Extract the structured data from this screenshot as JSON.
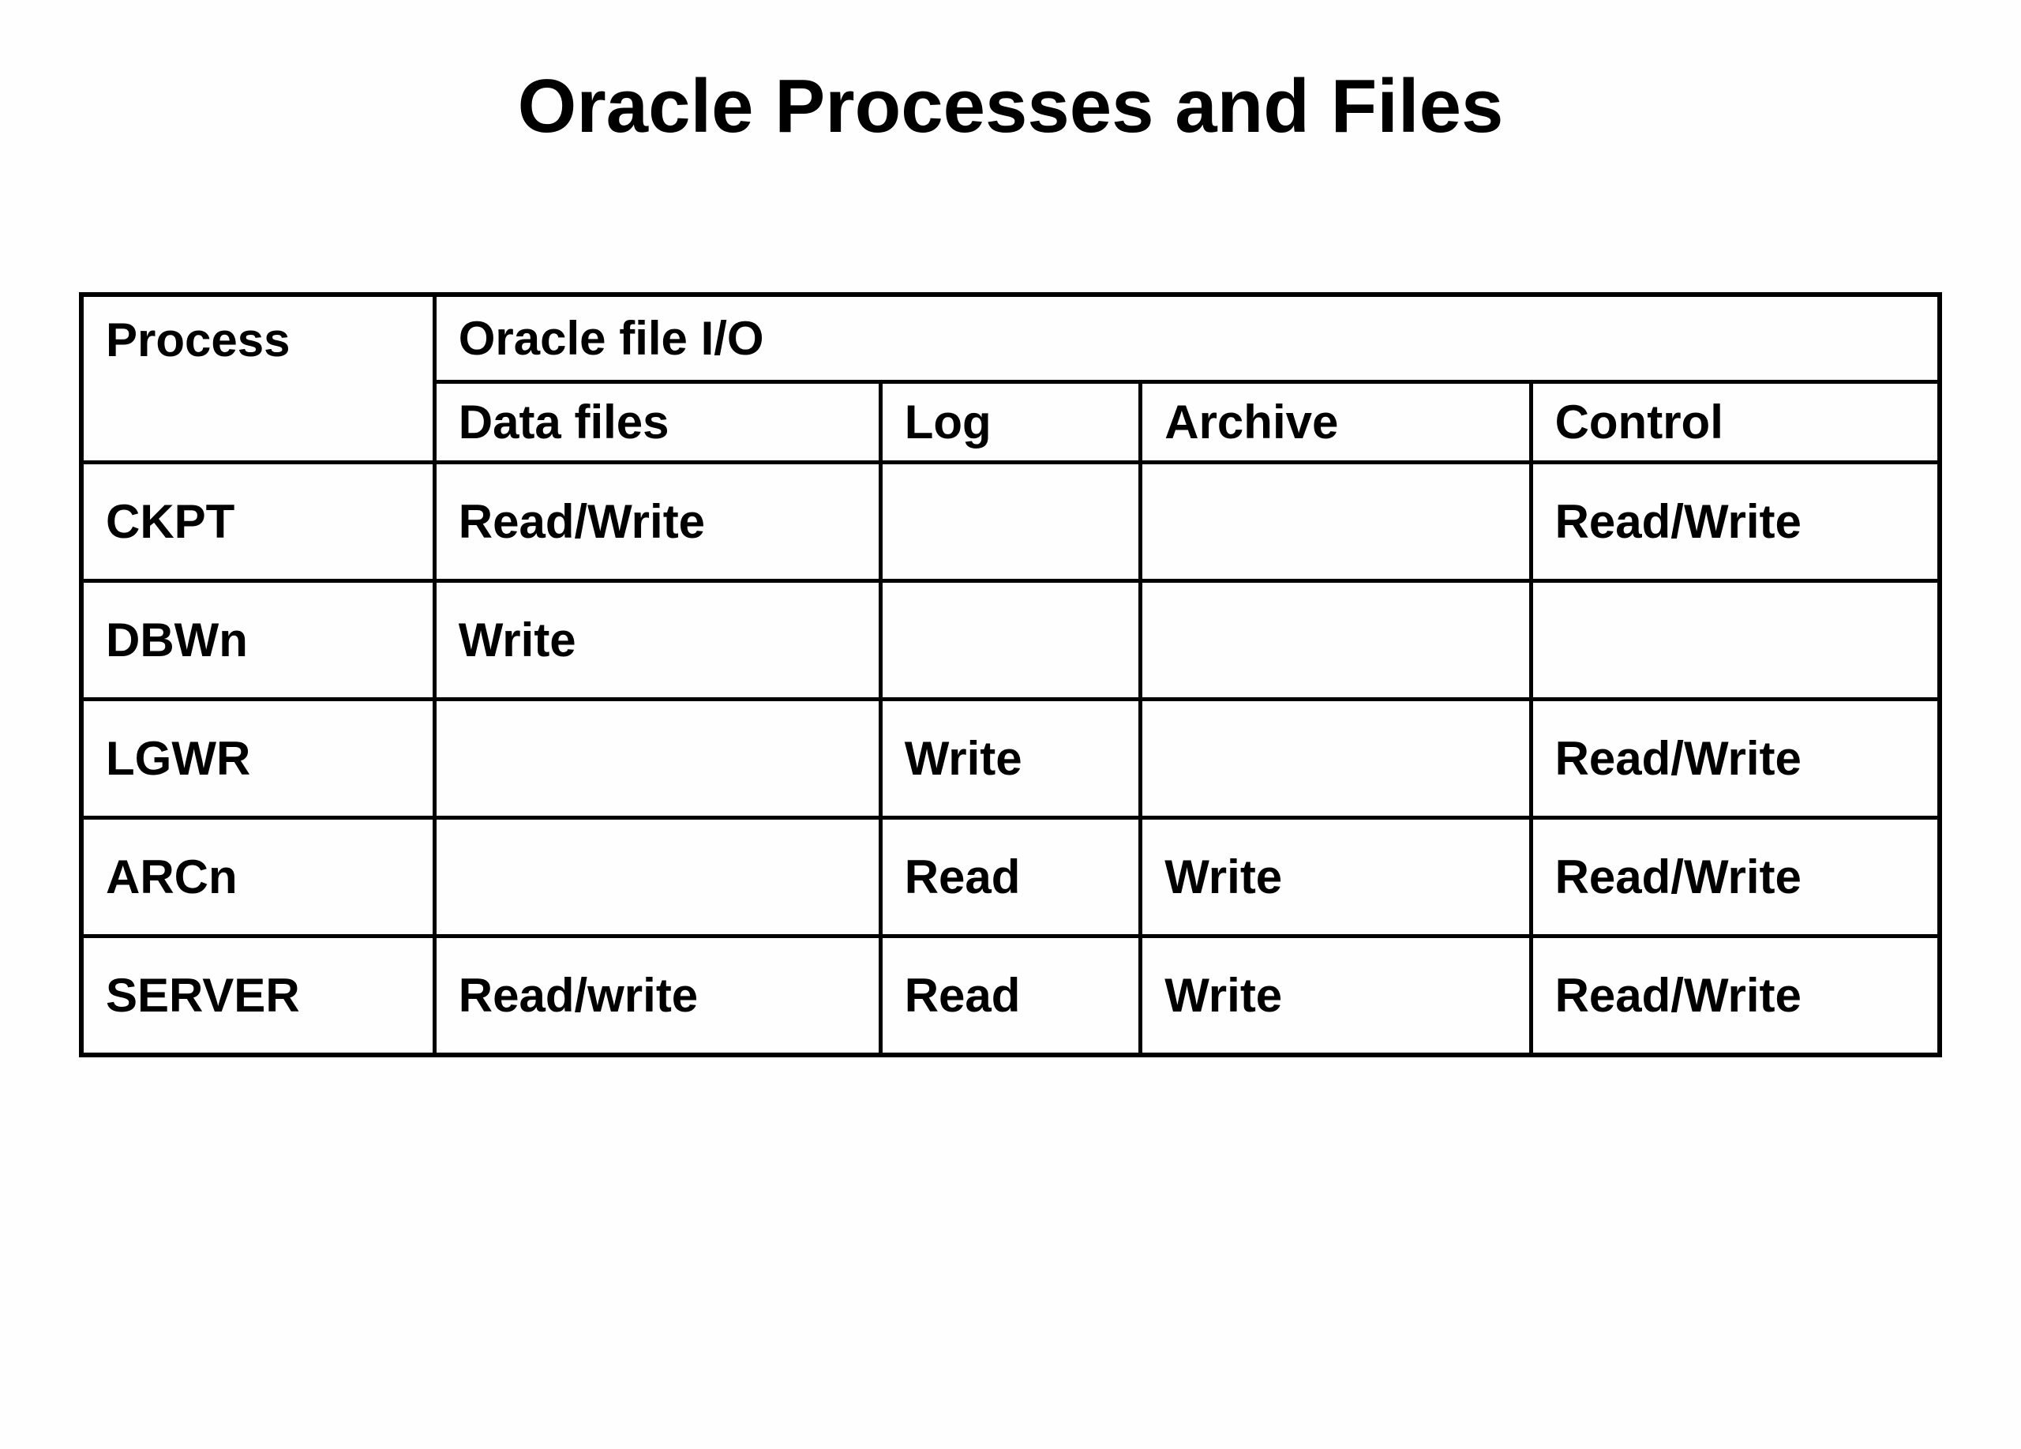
{
  "title": "Oracle Processes and Files",
  "headers": {
    "process": "Process",
    "group": "Oracle file I/O",
    "datafiles": "Data files",
    "log": "Log",
    "archive": "Archive",
    "control": "Control"
  },
  "rows": [
    {
      "process": "CKPT",
      "datafiles": "Read/Write",
      "log": "",
      "archive": "",
      "control": "Read/Write"
    },
    {
      "process": "DBWn",
      "datafiles": "Write",
      "log": "",
      "archive": "",
      "control": ""
    },
    {
      "process": "LGWR",
      "datafiles": "",
      "log": "Write",
      "archive": "",
      "control": "Read/Write"
    },
    {
      "process": "ARCn",
      "datafiles": "",
      "log": "Read",
      "archive": "Write",
      "control": "Read/Write"
    },
    {
      "process": "SERVER",
      "datafiles": "Read/write",
      "log": "Read",
      "archive": "Write",
      "control": "Read/Write"
    }
  ]
}
